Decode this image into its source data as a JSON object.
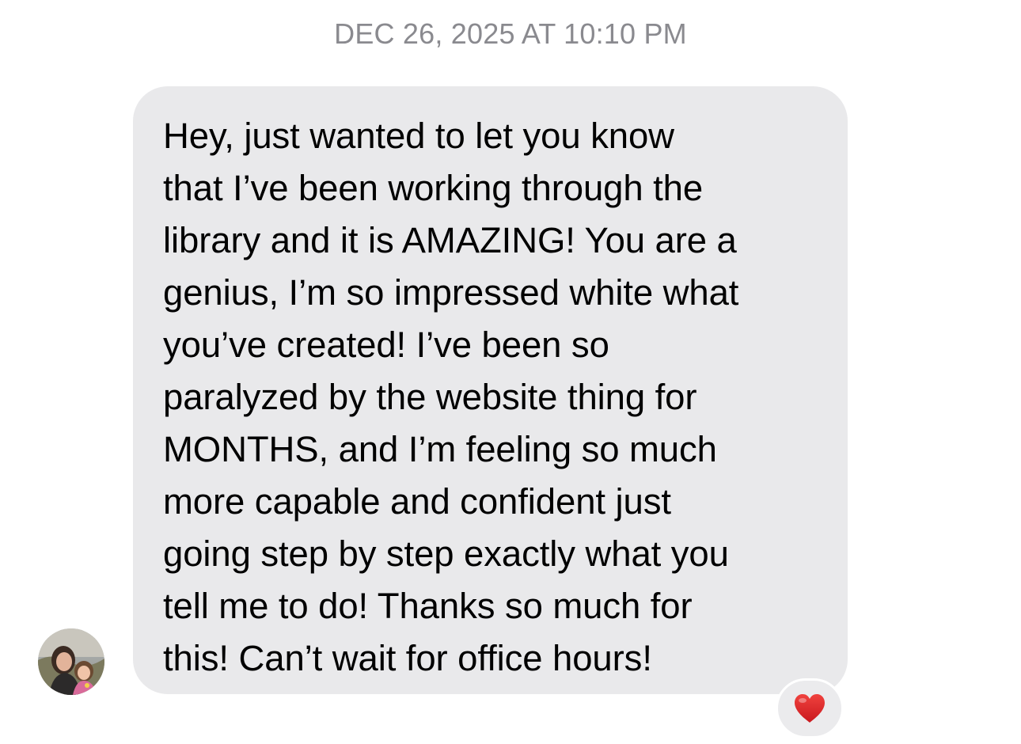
{
  "thread": {
    "timestamp": "DEC 26, 2025 AT 10:10 PM"
  },
  "message": {
    "text": "Hey, just wanted to let you know\nthat I’ve been working through the\nlibrary and it is AMAZING! You are a\ngenius, I’m so impressed white what\nyou’ve created! I’ve been so\nparalyzed by the website thing for\nMONTHS, and I’m feeling so much\nmore capable and confident just\ngoing step by step exactly what you\ntell me to do! Thanks so much for\nthis! Can’t wait for office hours!",
    "bubble_color": "#e9e9eb",
    "sender_avatar_icon": "contact-photo",
    "reaction": {
      "icon": "heart-icon",
      "color": "#e02424"
    }
  }
}
